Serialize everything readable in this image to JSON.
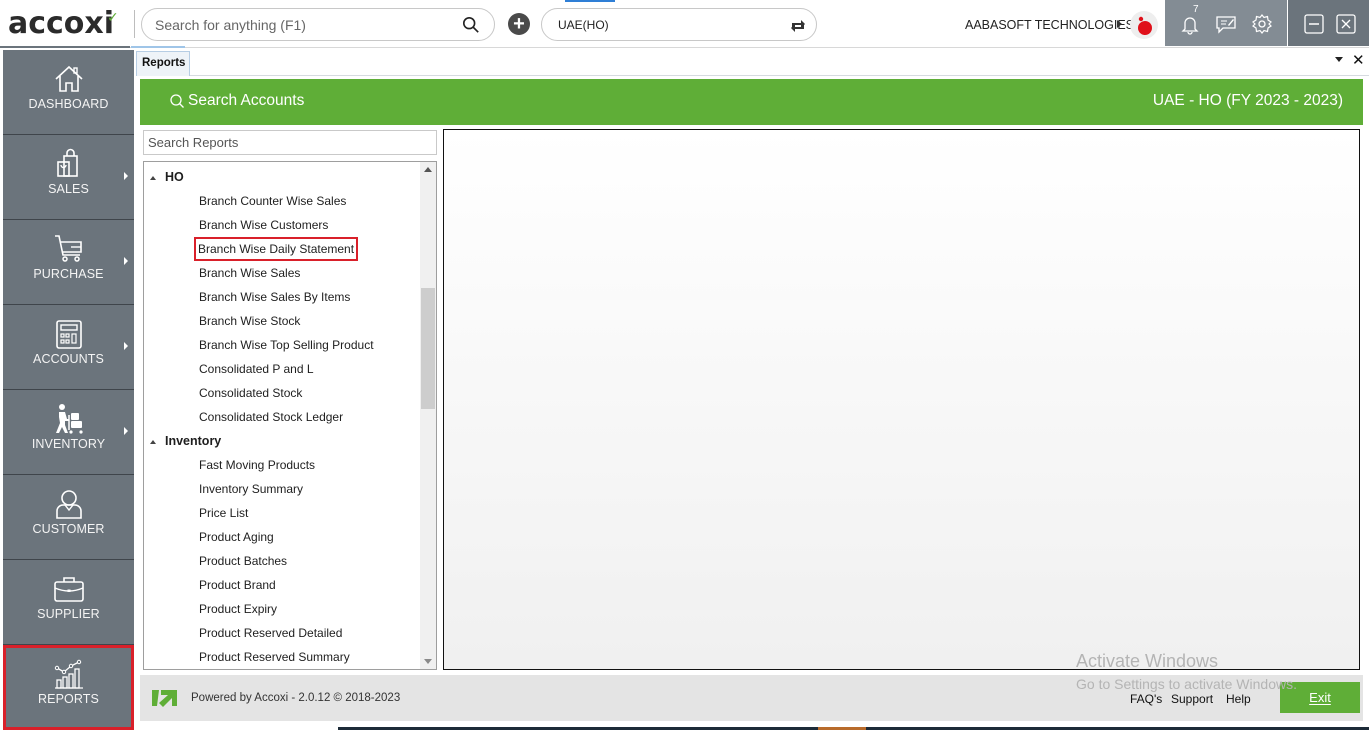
{
  "app": {
    "logo_text": "accoxi",
    "search": {
      "placeholder": "Search for anything (F1)",
      "value": ""
    },
    "branch_selector": {
      "value": "UAE(HO)"
    },
    "company_name": "AABASOFT TECHNOLOGIES",
    "notification_count": "7",
    "icons": {
      "search": "search-icon",
      "add": "plus-circle-icon",
      "refresh": "refresh-icon",
      "notifications": "bell-icon",
      "messages": "chat-edit-icon",
      "settings": "gear-icon",
      "minimize": "minimize-icon",
      "close": "close-icon"
    }
  },
  "sidebar": {
    "items": [
      {
        "label": "DASHBOARD",
        "icon": "home-icon",
        "has_submenu": false,
        "active": false
      },
      {
        "label": "SALES",
        "icon": "shopping-bags-icon",
        "has_submenu": true,
        "active": false
      },
      {
        "label": "PURCHASE",
        "icon": "cart-icon",
        "has_submenu": true,
        "active": false
      },
      {
        "label": "ACCOUNTS",
        "icon": "calculator-icon",
        "has_submenu": true,
        "active": false
      },
      {
        "label": "INVENTORY",
        "icon": "worker-trolley-icon",
        "has_submenu": true,
        "active": false
      },
      {
        "label": "CUSTOMER",
        "icon": "user-icon",
        "has_submenu": false,
        "active": false
      },
      {
        "label": "SUPPLIER",
        "icon": "briefcase-icon",
        "has_submenu": false,
        "active": false
      },
      {
        "label": "REPORTS",
        "icon": "chart-icon",
        "has_submenu": false,
        "active": true
      }
    ]
  },
  "tabs": [
    {
      "label": "Reports",
      "active": true
    }
  ],
  "header": {
    "search_accounts_label": "Search Accounts",
    "fiscal_label": "UAE - HO (FY 2023 - 2023)"
  },
  "reports": {
    "search_placeholder": "Search Reports",
    "groups": [
      {
        "name": "HO",
        "expanded": true,
        "items": [
          "Branch Counter Wise Sales",
          "Branch Wise Customers",
          "Branch Wise Daily Statement",
          "Branch Wise Sales",
          "Branch Wise Sales By Items",
          "Branch Wise Stock",
          "Branch Wise Top Selling Product",
          "Consolidated P and L",
          "Consolidated Stock",
          "Consolidated Stock Ledger"
        ]
      },
      {
        "name": "Inventory",
        "expanded": true,
        "items": [
          "Fast Moving Products",
          "Inventory Summary",
          "Price List",
          "Product Aging",
          "Product Batches",
          "Product Brand",
          "Product Expiry",
          "Product Reserved Detailed",
          "Product Reserved Summary"
        ]
      }
    ],
    "highlighted_item": "Branch Wise Daily Statement"
  },
  "footer": {
    "powered_by": "Powered by Accoxi - 2.0.12 © 2018-2023",
    "links": [
      "FAQ's",
      "Support",
      "Help"
    ],
    "exit_label": "Exit"
  },
  "watermark": {
    "line1": "Activate Windows",
    "line2": "Go to Settings to activate Windows."
  },
  "colors": {
    "brand_green": "#5fae37",
    "sidebar_bg": "#6b747c",
    "highlight_red": "#d9202a"
  }
}
